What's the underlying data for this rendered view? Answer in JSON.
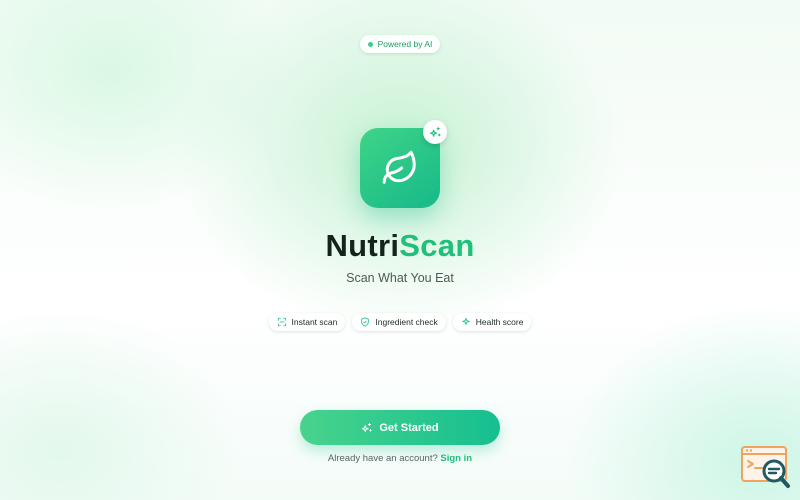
{
  "badge": {
    "text": "Powered by AI"
  },
  "app": {
    "name_part1": "Nutri",
    "name_part2": "Scan",
    "tagline": "Scan What You Eat"
  },
  "features": [
    {
      "label": "Instant scan",
      "icon": "scan-icon"
    },
    {
      "label": "Ingredient check",
      "icon": "shield-check-icon"
    },
    {
      "label": "Health score",
      "icon": "sparkle-icon"
    }
  ],
  "cta": {
    "label": "Get Started",
    "icon": "sparkle-icon"
  },
  "signin": {
    "prompt": "Already have an account?",
    "link": "Sign in"
  },
  "colors": {
    "brand": "#1fbf7c",
    "brand_dark": "#16b98a",
    "text_dark": "#14241c",
    "logo_orange": "#f0a35c",
    "logo_teal": "#1e5a63"
  }
}
